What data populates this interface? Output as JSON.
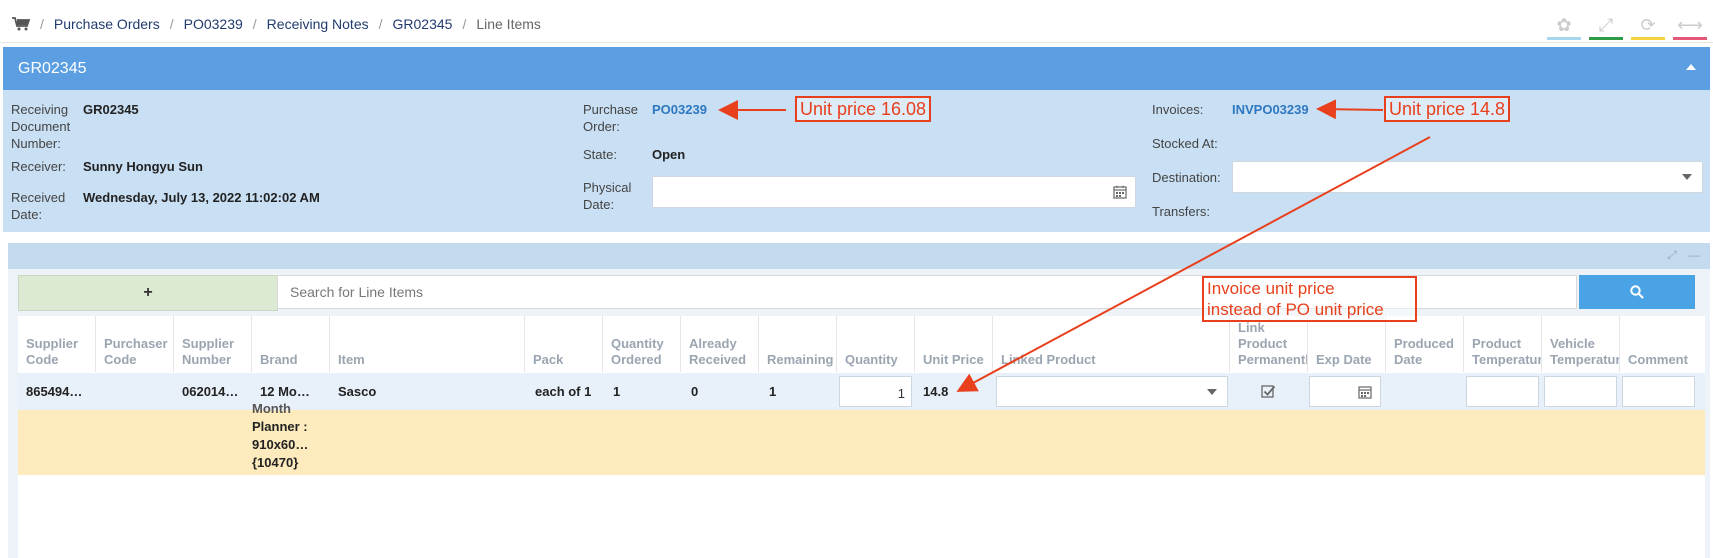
{
  "breadcrumb": {
    "items": [
      "Purchase Orders",
      "PO03239",
      "Receiving Notes",
      "GR02345"
    ],
    "current": "Line Items",
    "separator": "/"
  },
  "top_icons": [
    {
      "icon": "paw-icon",
      "color": "#a7d6ee"
    },
    {
      "icon": "expand-icon",
      "color": "#2e9c46"
    },
    {
      "icon": "refresh-icon",
      "color": "#f6d23f"
    },
    {
      "icon": "horizontal-resize-icon",
      "color": "#e6577a"
    }
  ],
  "panel": {
    "title": "GR02345"
  },
  "info": {
    "receiving_doc_label": "Receiving Document Number:",
    "receiving_doc_value": "GR02345",
    "receiver_label": "Receiver:",
    "receiver_value": "Sunny Hongyu Sun",
    "received_date_label": "Received Date:",
    "received_date_value": "Wednesday, July 13, 2022 11:02:02 AM",
    "purchase_order_label": "Purchase Order:",
    "purchase_order_value": "PO03239",
    "state_label": "State:",
    "state_value": "Open",
    "physical_date_label": "Physical Date:",
    "physical_date_value": "",
    "invoices_label": "Invoices:",
    "invoices_value": "INVPO03239",
    "stocked_at_label": "Stocked At:",
    "destination_label": "Destination:",
    "destination_value": "",
    "transfers_label": "Transfers:"
  },
  "line_items": {
    "add_label": "+",
    "search_placeholder": "Search for Line Items",
    "columns": [
      "Supplier Code",
      "Purchaser Code",
      "Supplier Number",
      "Brand",
      "Item",
      "Pack",
      "Quantity Ordered",
      "Already Received",
      "Remaining",
      "Quantity",
      "Unit Price",
      "Linked Product",
      "Link Product Permanently",
      "Exp Date",
      "Produced Date",
      "Product Temperature",
      "Vehicle Temperature",
      "Comment"
    ],
    "row": {
      "supplier_code": "865494…",
      "purchaser_code": "",
      "supplier_number": "062014…",
      "brand": "12 Mo…",
      "item": "Sasco",
      "pack": "each of 1",
      "quantity_ordered": "1",
      "already_received": "0",
      "remaining": "1",
      "quantity": "1",
      "unit_price": "14.8",
      "brand_detail": [
        "Month",
        "Planner :",
        "910x60…",
        "{10470}"
      ]
    }
  },
  "annotations": {
    "po_price": "Unit price 16.08",
    "invoice_price": "Unit price 14.8",
    "note_line1": "Invoice unit price",
    "note_line2": "instead of PO unit price",
    "color": "#e8401c"
  }
}
